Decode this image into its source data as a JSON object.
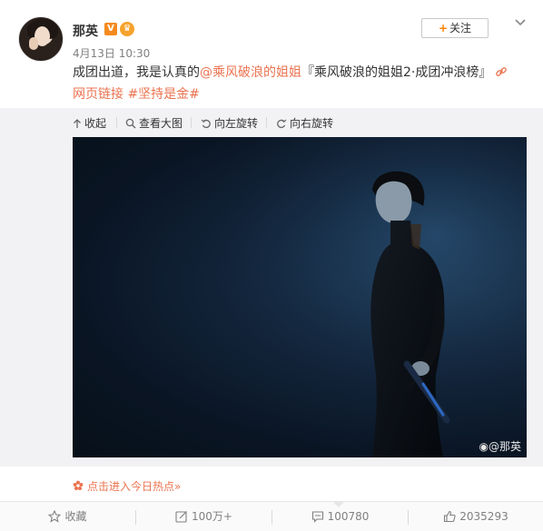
{
  "header": {
    "username": "那英",
    "vip_badge": "V",
    "crown_badge": "♛",
    "timestamp": "4月13日 10:30",
    "follow_label": "关注",
    "follow_plus": "+"
  },
  "post": {
    "text_prefix": "成团出道，我是认真的",
    "mention": "@乘风破浪的姐姐",
    "quote": "『乘风破浪的姐姐2·成团冲浪榜』",
    "link_label": "网页链接",
    "hashtag": "#坚持是金#"
  },
  "media_toolbar": {
    "collapse": "收起",
    "view_large": "查看大图",
    "rotate_left": "向左旋转",
    "rotate_right": "向右旋转"
  },
  "photo": {
    "watermark": "@那英"
  },
  "hotspot": {
    "label": "点击进入今日热点»"
  },
  "footer": {
    "favorite": "收藏",
    "repost": "100万+",
    "comment": "100780",
    "like": "2035293"
  },
  "colors": {
    "link": "#eb7350",
    "accent": "#ff8200",
    "muted": "#808080"
  }
}
